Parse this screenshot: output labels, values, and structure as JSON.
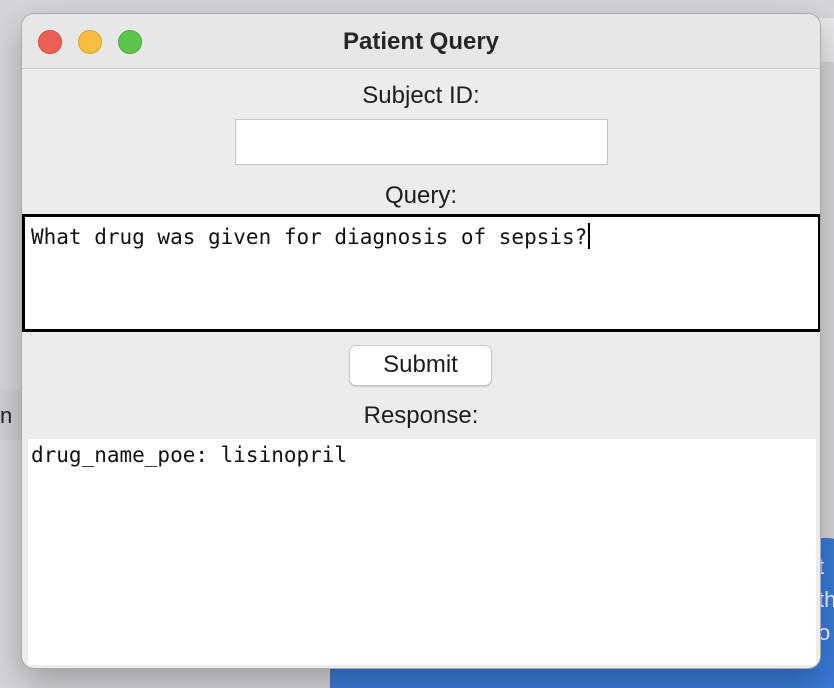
{
  "window": {
    "title": "Patient Query"
  },
  "form": {
    "subject_label": "Subject ID:",
    "subject_value": "",
    "query_label": "Query:",
    "query_value": "What drug was given for diagnosis of sepsis?",
    "submit_label": "Submit",
    "response_label": "Response:",
    "response_value": "drug_name_poe: lisinopril"
  },
  "background": {
    "left_tab_text": "n",
    "right_edge_text": [
      "t",
      "th",
      "o"
    ]
  },
  "colors": {
    "close": "#ee5f56",
    "minimize": "#f6be40",
    "zoom": "#5dc44b",
    "background_panel": "#3a7ad8"
  },
  "icons": [
    "close-window-icon",
    "minimize-window-icon",
    "zoom-window-icon"
  ]
}
